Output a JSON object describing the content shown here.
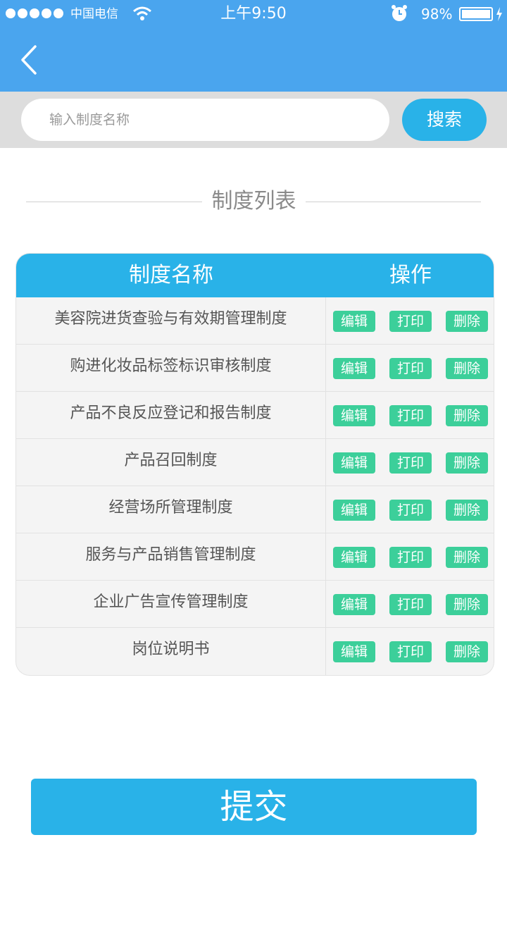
{
  "status_bar": {
    "carrier": "中国电信",
    "time": "上午9:50",
    "battery": "98%",
    "icons": [
      "signal-dots-icon",
      "wifi-icon",
      "alarm-icon",
      "battery-icon",
      "charging-bolt-icon"
    ]
  },
  "nav": {
    "back_icon": "chevron-left-icon"
  },
  "search": {
    "placeholder": "输入制度名称",
    "value": "",
    "button_label": "搜索"
  },
  "section": {
    "title": "制度列表"
  },
  "table": {
    "headers": {
      "name": "制度名称",
      "actions": "操作"
    },
    "rows": [
      {
        "name": "美容院进货查验与有效期管理制度"
      },
      {
        "name": "购进化妆品标签标识审核制度"
      },
      {
        "name": "产品不良反应登记和报告制度"
      },
      {
        "name": "产品召回制度"
      },
      {
        "name": "经营场所管理制度"
      },
      {
        "name": "服务与产品销售管理制度"
      },
      {
        "name": "企业广告宣传管理制度"
      },
      {
        "name": "岗位说明书"
      }
    ],
    "action_labels": {
      "edit": "编辑",
      "print": "打印",
      "delete": "删除"
    }
  },
  "submit_label": "提交",
  "colors": {
    "header_blue": "#4aa5ee",
    "accent_blue": "#29b2e8",
    "action_green": "#3ccf9a"
  }
}
